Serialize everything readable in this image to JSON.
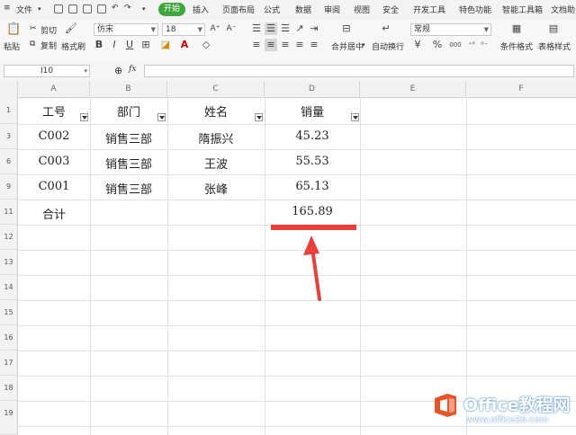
{
  "menu": {
    "file": "文件",
    "active_tab": "开始",
    "tabs": [
      "插入",
      "页面布局",
      "公式",
      "数据",
      "审阅",
      "视图",
      "安全",
      "开发工具",
      "特色功能",
      "智能工具箱",
      "文档助"
    ]
  },
  "ribbon": {
    "paste": "粘贴",
    "cut": "剪切",
    "copy": "复制",
    "format_painter": "格式刷",
    "font_name": "仿宋",
    "font_size": "18",
    "bold": "B",
    "italic": "I",
    "underline": "U",
    "font_color_letter": "A",
    "grow_font": "A⁺",
    "shrink_font": "A⁻",
    "merge_center": "合并居中",
    "wrap_text": "自动换行",
    "number_format": "常规",
    "currency": "¥",
    "percent": "%",
    "thousands": "000",
    "cond_format": "条件格式",
    "table_style": "表格样式"
  },
  "formula_bar": {
    "name_box": "I10",
    "fx": "fx",
    "formula": ""
  },
  "columns": [
    "A",
    "B",
    "C",
    "D",
    "E",
    "F"
  ],
  "rows": [
    "1",
    "3",
    "6",
    "9",
    "11",
    "12",
    "13",
    "14",
    "15",
    "16",
    "17",
    "18",
    "19"
  ],
  "table": {
    "headers": [
      "工号",
      "部门",
      "姓名",
      "销量"
    ],
    "data": [
      [
        "C002",
        "销售三部",
        "隋振兴",
        "45.23"
      ],
      [
        "C003",
        "销售三部",
        "王波",
        "55.53"
      ],
      [
        "C001",
        "销售三部",
        "张峰",
        "65.13"
      ]
    ],
    "total_label": "合计",
    "total_value": "165.89"
  },
  "annotation_color": "#e8413b",
  "watermark": {
    "title": "Office教程网",
    "url": "www.office26.com"
  }
}
